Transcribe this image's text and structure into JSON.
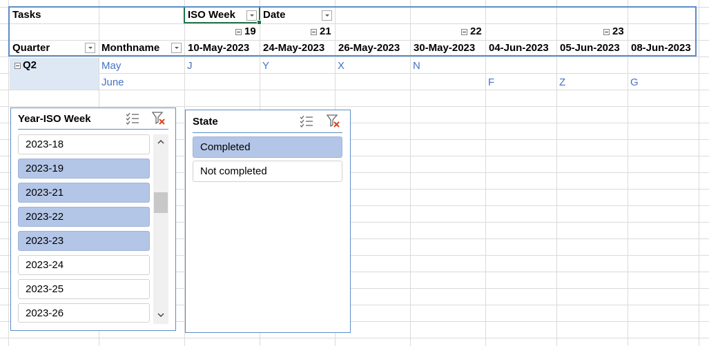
{
  "pivot": {
    "tasks_label": "Tasks",
    "iso_week_label": "ISO Week",
    "date_label": "Date",
    "quarter_label": "Quarter",
    "monthname_label": "Monthname",
    "weeks": [
      "19",
      "21",
      "22",
      "23"
    ],
    "dates": [
      "10-May-2023",
      "24-May-2023",
      "26-May-2023",
      "30-May-2023",
      "04-Jun-2023",
      "05-Jun-2023",
      "08-Jun-2023"
    ],
    "quarter": "Q2",
    "months": [
      "May",
      "June"
    ],
    "may_values": [
      "J",
      "Y",
      "X",
      "N"
    ],
    "june_values": [
      "F",
      "Z",
      "G"
    ]
  },
  "slicer_week": {
    "title": "Year-ISO Week",
    "icons": [
      "multi-select-icon",
      "clear-filter-icon"
    ],
    "items": [
      {
        "label": "2023-18",
        "selected": false
      },
      {
        "label": "2023-19",
        "selected": true
      },
      {
        "label": "2023-21",
        "selected": true
      },
      {
        "label": "2023-22",
        "selected": true
      },
      {
        "label": "2023-23",
        "selected": true
      },
      {
        "label": "2023-24",
        "selected": false
      },
      {
        "label": "2023-25",
        "selected": false
      },
      {
        "label": "2023-26",
        "selected": false
      }
    ]
  },
  "slicer_state": {
    "title": "State",
    "icons": [
      "multi-select-icon",
      "clear-filter-icon"
    ],
    "items": [
      {
        "label": "Completed",
        "selected": true
      },
      {
        "label": "Not completed",
        "selected": false
      }
    ]
  },
  "colors": {
    "accent": "#5b8bc7",
    "selected_item": "#b4c6e7",
    "value_text": "#4472c4",
    "active_cell": "#217346"
  }
}
